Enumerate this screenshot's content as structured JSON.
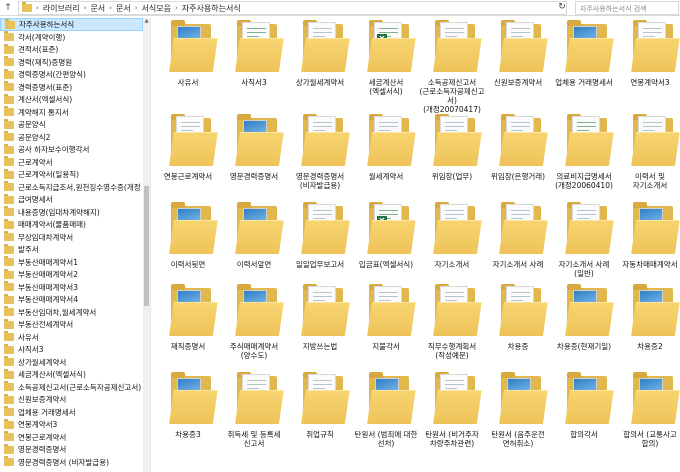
{
  "address": {
    "crumbs": [
      "라이브러리",
      "문서",
      "문서",
      "서식모음",
      "자주사용하는서식"
    ],
    "search_placeholder": "자주사용하는서식 검색"
  },
  "tree": {
    "items": [
      {
        "label": "자주사용하는서식",
        "selected": true
      },
      {
        "label": "각서(계약이행)"
      },
      {
        "label": "견적서(표준)"
      },
      {
        "label": "경력(재직)증명원"
      },
      {
        "label": "경력증명서(간편양식)"
      },
      {
        "label": "경력증명서(표준)"
      },
      {
        "label": "계산서(엑셀서식)"
      },
      {
        "label": "계약해지 통지서"
      },
      {
        "label": "공문양식"
      },
      {
        "label": "공문양식2"
      },
      {
        "label": "공사 하자보수이행각서"
      },
      {
        "label": "근로계약서"
      },
      {
        "label": "근로계약서(일용직)"
      },
      {
        "label": "근로소득지급조서,원천징수영수증(개정"
      },
      {
        "label": "급여명세서"
      },
      {
        "label": "내용증명(임대차계약해지)"
      },
      {
        "label": "매매계약서(물품매매)"
      },
      {
        "label": "무상임대차계약서"
      },
      {
        "label": "발주서"
      },
      {
        "label": "부동산매매계약서1"
      },
      {
        "label": "부동산매매계약서2"
      },
      {
        "label": "부동산매매계약서3"
      },
      {
        "label": "부동산매매계약서4"
      },
      {
        "label": "부동산임대차,월세계약서"
      },
      {
        "label": "부동산전세계약서"
      },
      {
        "label": "사유서"
      },
      {
        "label": "사직서3"
      },
      {
        "label": "상가월세계약서"
      },
      {
        "label": "세금계산서(엑셀서식)"
      },
      {
        "label": "소득공제신고서(근로소득자공제신고서)"
      },
      {
        "label": "신원보증계약서"
      },
      {
        "label": "업체용 거래명세서"
      },
      {
        "label": "연봉계약서3"
      },
      {
        "label": "연봉근로계약서"
      },
      {
        "label": "영문경력증명서"
      },
      {
        "label": "영문경력증명서 (비자발급용)"
      }
    ]
  },
  "grid": {
    "items": [
      {
        "label": "사유서",
        "icon": "folder-photo-icon"
      },
      {
        "label": "사직서3",
        "icon": "folder-xls-icon"
      },
      {
        "label": "상가월세계약서",
        "icon": "folder-doc-icon"
      },
      {
        "label": "세금계산서(엑셀서식)",
        "icon": "folder-excel-icon"
      },
      {
        "label": "소득공제신고서(근로소득자공제신고서)(개정20070417)",
        "icon": "folder-doc-icon"
      },
      {
        "label": "신원보증계약서",
        "icon": "folder-doc-icon"
      },
      {
        "label": "업체용 거래명세서",
        "icon": "folder-photo-icon"
      },
      {
        "label": "연봉계약서3",
        "icon": "folder-doc-icon"
      },
      {
        "label": "연봉근로계약서",
        "icon": "folder-doc-icon"
      },
      {
        "label": "영문경력증명서",
        "icon": "folder-photo-icon"
      },
      {
        "label": "영문경력증명서 (비자발급용)",
        "icon": "folder-doc-icon"
      },
      {
        "label": "월세계약서",
        "icon": "folder-doc-icon"
      },
      {
        "label": "위임장(업무)",
        "icon": "folder-doc-icon"
      },
      {
        "label": "위임장(은행거래)",
        "icon": "folder-doc-icon"
      },
      {
        "label": "의료비지급명세서(개정20060410)",
        "icon": "folder-xls-icon"
      },
      {
        "label": "이력서 및 자기소개서",
        "icon": "folder-doc-icon"
      },
      {
        "label": "이력서뒷면",
        "icon": "folder-photo-icon"
      },
      {
        "label": "이력서앞면",
        "icon": "folder-photo-icon"
      },
      {
        "label": "일일업무보고서",
        "icon": "folder-doc-icon"
      },
      {
        "label": "입금표(엑셀서식)",
        "icon": "folder-excel-icon"
      },
      {
        "label": "자기소개서",
        "icon": "folder-doc-icon"
      },
      {
        "label": "자기소개서 사례",
        "icon": "folder-doc-icon"
      },
      {
        "label": "자기소개서 사례(일반)",
        "icon": "folder-doc-icon"
      },
      {
        "label": "자동차매매계약서",
        "icon": "folder-photo-icon"
      },
      {
        "label": "재직증명서",
        "icon": "folder-photo-icon"
      },
      {
        "label": "주식매매계약서(양수도)",
        "icon": "folder-photo-icon"
      },
      {
        "label": "지방쓰는법",
        "icon": "folder-doc-icon"
      },
      {
        "label": "지불각서",
        "icon": "folder-doc-icon"
      },
      {
        "label": "직무수행계획서(작성예문)",
        "icon": "folder-doc-icon"
      },
      {
        "label": "차용증",
        "icon": "folder-doc-icon"
      },
      {
        "label": "차용증(현재기일)",
        "icon": "folder-photo-icon"
      },
      {
        "label": "차용증2",
        "icon": "folder-photo-icon"
      },
      {
        "label": "차용증3",
        "icon": "folder-photo-icon"
      },
      {
        "label": "취득세 및 등록세 신고서",
        "icon": "folder-doc-icon"
      },
      {
        "label": "취업규칙",
        "icon": "folder-doc-icon"
      },
      {
        "label": "탄원서 (범죄에 대한 선처)",
        "icon": "folder-photo-icon"
      },
      {
        "label": "탄원서 (비거주자 차량주차관련)",
        "icon": "folder-doc-icon"
      },
      {
        "label": "탄원서 (음주운전 면허취소)",
        "icon": "folder-photo-icon"
      },
      {
        "label": "합의각서",
        "icon": "folder-photo-icon"
      },
      {
        "label": "합의서 (교통사고 합의)",
        "icon": "folder-photo-icon"
      }
    ]
  }
}
